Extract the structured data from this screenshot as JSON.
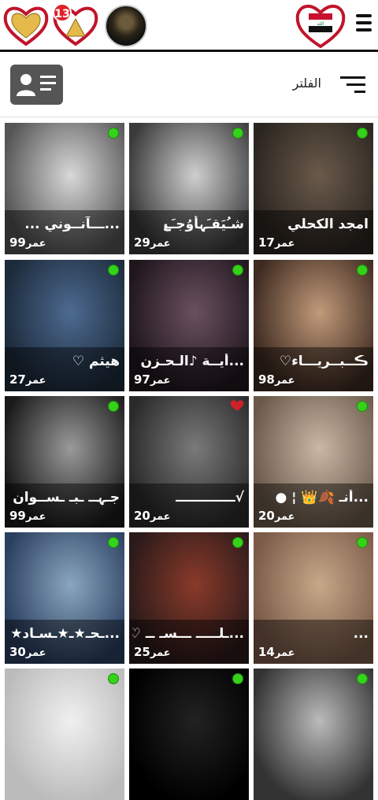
{
  "header": {
    "notification_count": "13",
    "menu_icon": "hamburger-icon"
  },
  "filter": {
    "label": "الفلتر",
    "contact_icon": "contact-card-icon",
    "filter_icon": "filter-lines-icon"
  },
  "age_suffix": "عمر",
  "users": [
    {
      "name": "امجد الكحلي",
      "age": "17",
      "online": true,
      "c1": "#6a5a4a",
      "c2": "#2b2520"
    },
    {
      "name": "شـُيَقـَہأوُجـَۓ",
      "age": "29",
      "online": true,
      "c1": "#cfcfcf",
      "c2": "#3a3a3a"
    },
    {
      "name": "...ـــآنــوني ...",
      "age": "99",
      "online": true,
      "c1": "#d8d8d8",
      "c2": "#555555"
    },
    {
      "name": "ڪــبــريـــاء♡",
      "age": "98",
      "online": true,
      "c1": "#c29a7a",
      "c2": "#3d2a20"
    },
    {
      "name": "...أيــة ♪الـحـزن",
      "age": "97",
      "online": true,
      "c1": "#6a5060",
      "c2": "#1f161c"
    },
    {
      "name": "هيثم ♡",
      "age": "27",
      "online": true,
      "c1": "#4c6a90",
      "c2": "#1c2a3a"
    },
    {
      "name": "...أنـ 🍂👑 ¦ ●",
      "age": "20",
      "online": true,
      "c1": "#c9b8a6",
      "c2": "#6b5a4a"
    },
    {
      "name": "√ـــــــــــــ",
      "age": "20",
      "online": false,
      "c1": "#7a7a7a",
      "c2": "#2a2a2a"
    },
    {
      "name": "جـہــ ـبـ ـســوان",
      "age": "99",
      "online": true,
      "c1": "#9a9a9a",
      "c2": "#1a1a1a"
    },
    {
      "name": "...",
      "age": "14",
      "online": true,
      "c1": "#c8a888",
      "c2": "#7a5a48"
    },
    {
      "name": "...ـلـــــ ـــسـ ــ ♡",
      "age": "25",
      "online": true,
      "c1": "#8a3a2a",
      "c2": "#2a1a1a"
    },
    {
      "name": "...ـحـ★ـ★ـسـاد★",
      "age": "30",
      "online": true,
      "c1": "#8aa6c0",
      "c2": "#2a4060"
    },
    {
      "name": "",
      "age": "",
      "online": true,
      "c1": "#bbbbbb",
      "c2": "#333333"
    },
    {
      "name": "",
      "age": "",
      "online": true,
      "c1": "#222222",
      "c2": "#000000"
    },
    {
      "name": "",
      "age": "",
      "online": true,
      "c1": "#f0f0f0",
      "c2": "#bbbbbb"
    }
  ]
}
